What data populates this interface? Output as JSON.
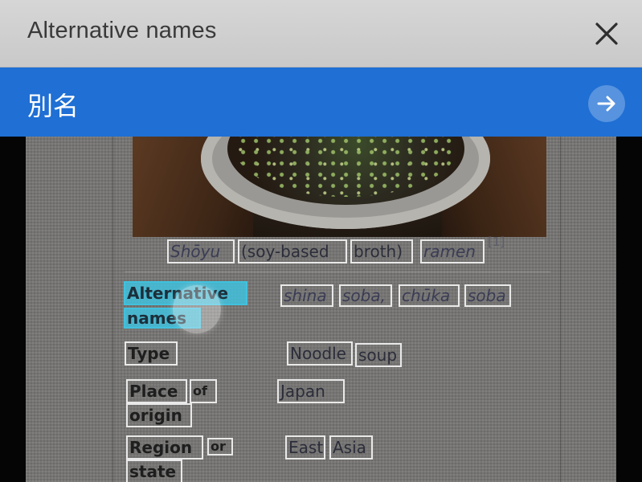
{
  "header": {
    "title": "Alternative names",
    "close_icon": "close-icon"
  },
  "translation": {
    "text": "別名",
    "go_icon": "arrow-right-icon",
    "bar_color": "#1f6fd4"
  },
  "ocr": {
    "caption": [
      "Shōyu",
      "(soy-based",
      "broth)",
      "ramen"
    ],
    "caption_ref": "[1]",
    "alt_label": [
      "Alternative",
      "names"
    ],
    "alt_value": [
      "shina",
      "soba,",
      "chūka",
      "soba"
    ],
    "type_label": "Type",
    "type_value": [
      "Noodle",
      "soup"
    ],
    "place_label": [
      "Place",
      "of",
      "origin"
    ],
    "place_value": "Japan",
    "region_label": [
      "Region",
      "or",
      "state"
    ],
    "region_value": [
      "East",
      "Asia"
    ],
    "highlight_color": "#41c1dd"
  }
}
